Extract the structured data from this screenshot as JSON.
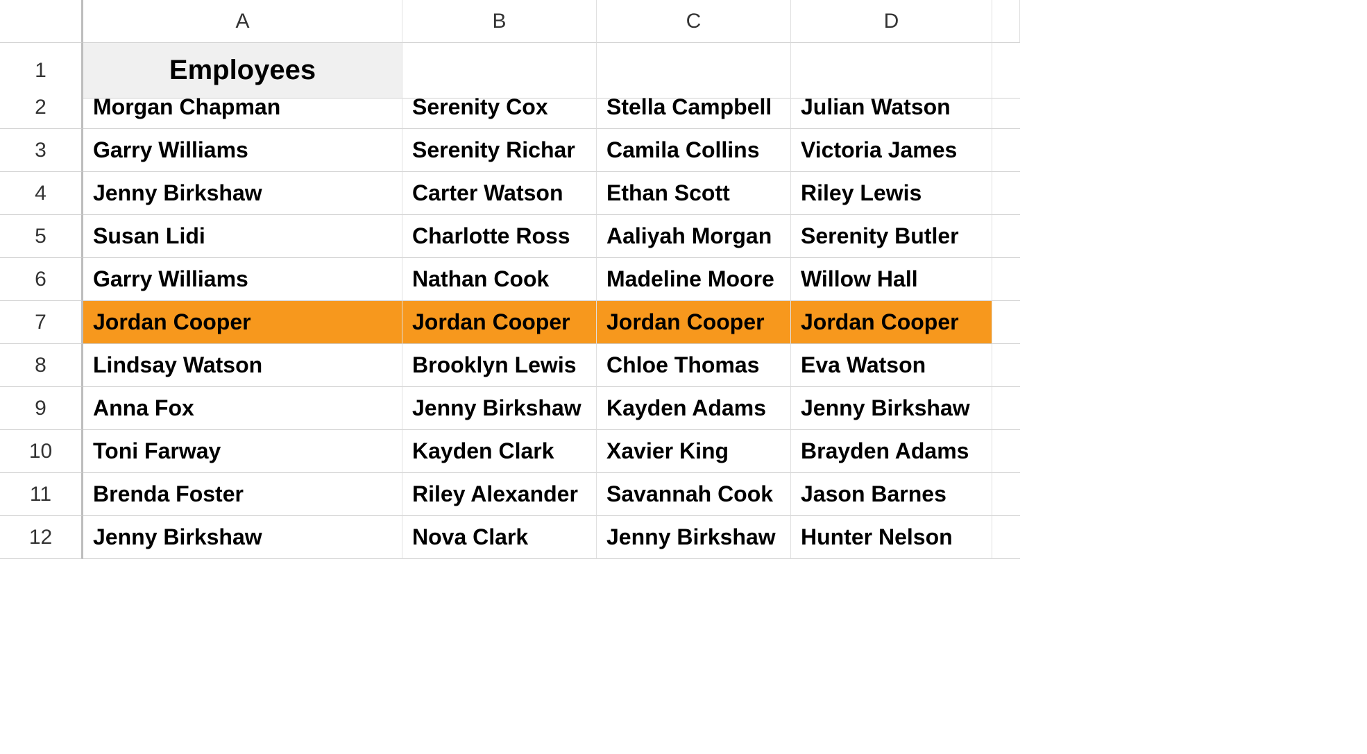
{
  "columns": [
    "A",
    "B",
    "C",
    "D"
  ],
  "title": "Employees",
  "highlight_row_index": 5,
  "rows": [
    [
      "Morgan Chapman",
      "Serenity Cox",
      "Stella Campbell",
      "Julian Watson"
    ],
    [
      "Garry Williams",
      "Serenity Richar",
      "Camila Collins",
      "Victoria James"
    ],
    [
      "Jenny Birkshaw",
      "Carter Watson",
      "Ethan Scott",
      "Riley Lewis"
    ],
    [
      "Susan Lidi",
      "Charlotte Ross",
      "Aaliyah Morgan",
      "Serenity Butler"
    ],
    [
      "Garry Williams",
      "Nathan Cook",
      "Madeline Moore",
      "Willow Hall"
    ],
    [
      "Jordan Cooper",
      "Jordan Cooper",
      "Jordan Cooper",
      "Jordan Cooper"
    ],
    [
      "Lindsay Watson",
      "Brooklyn Lewis",
      "Chloe Thomas",
      "Eva Watson"
    ],
    [
      "Anna Fox",
      "Jenny Birkshaw",
      "Kayden Adams",
      "Jenny Birkshaw"
    ],
    [
      "Toni Farway",
      "Kayden Clark",
      "Xavier King",
      "Brayden Adams"
    ],
    [
      "Brenda Foster",
      "Riley Alexander",
      "Savannah Cook",
      "Jason Barnes"
    ],
    [
      "Jenny Birkshaw",
      "Nova Clark",
      "Jenny Birkshaw",
      "Hunter Nelson"
    ]
  ]
}
